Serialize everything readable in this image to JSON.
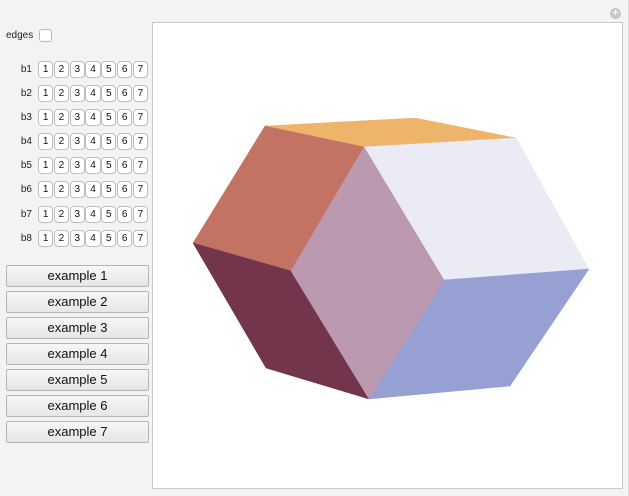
{
  "controls": {
    "edges_label": "edges",
    "edges_checked": false,
    "rows": [
      {
        "label": "b1",
        "options": [
          "1",
          "2",
          "3",
          "4",
          "5",
          "6",
          "7"
        ]
      },
      {
        "label": "b2",
        "options": [
          "1",
          "2",
          "3",
          "4",
          "5",
          "6",
          "7"
        ]
      },
      {
        "label": "b3",
        "options": [
          "1",
          "2",
          "3",
          "4",
          "5",
          "6",
          "7"
        ]
      },
      {
        "label": "b4",
        "options": [
          "1",
          "2",
          "3",
          "4",
          "5",
          "6",
          "7"
        ]
      },
      {
        "label": "b5",
        "options": [
          "1",
          "2",
          "3",
          "4",
          "5",
          "6",
          "7"
        ]
      },
      {
        "label": "b6",
        "options": [
          "1",
          "2",
          "3",
          "4",
          "5",
          "6",
          "7"
        ]
      },
      {
        "label": "b7",
        "options": [
          "1",
          "2",
          "3",
          "4",
          "5",
          "6",
          "7"
        ]
      },
      {
        "label": "b8",
        "options": [
          "1",
          "2",
          "3",
          "4",
          "5",
          "6",
          "7"
        ]
      }
    ],
    "examples": [
      "example 1",
      "example 2",
      "example 3",
      "example 4",
      "example 5",
      "example 6",
      "example 7"
    ]
  },
  "corner_icon": "plus-icon",
  "colors": {
    "top_face": "#eeb46a",
    "upper_left_face": "#c37363",
    "front_face": "#bb99b0",
    "upper_right_face": "#ebebf5",
    "lower_left_face": "#72354c",
    "lower_right_face": "#97a0d3"
  }
}
